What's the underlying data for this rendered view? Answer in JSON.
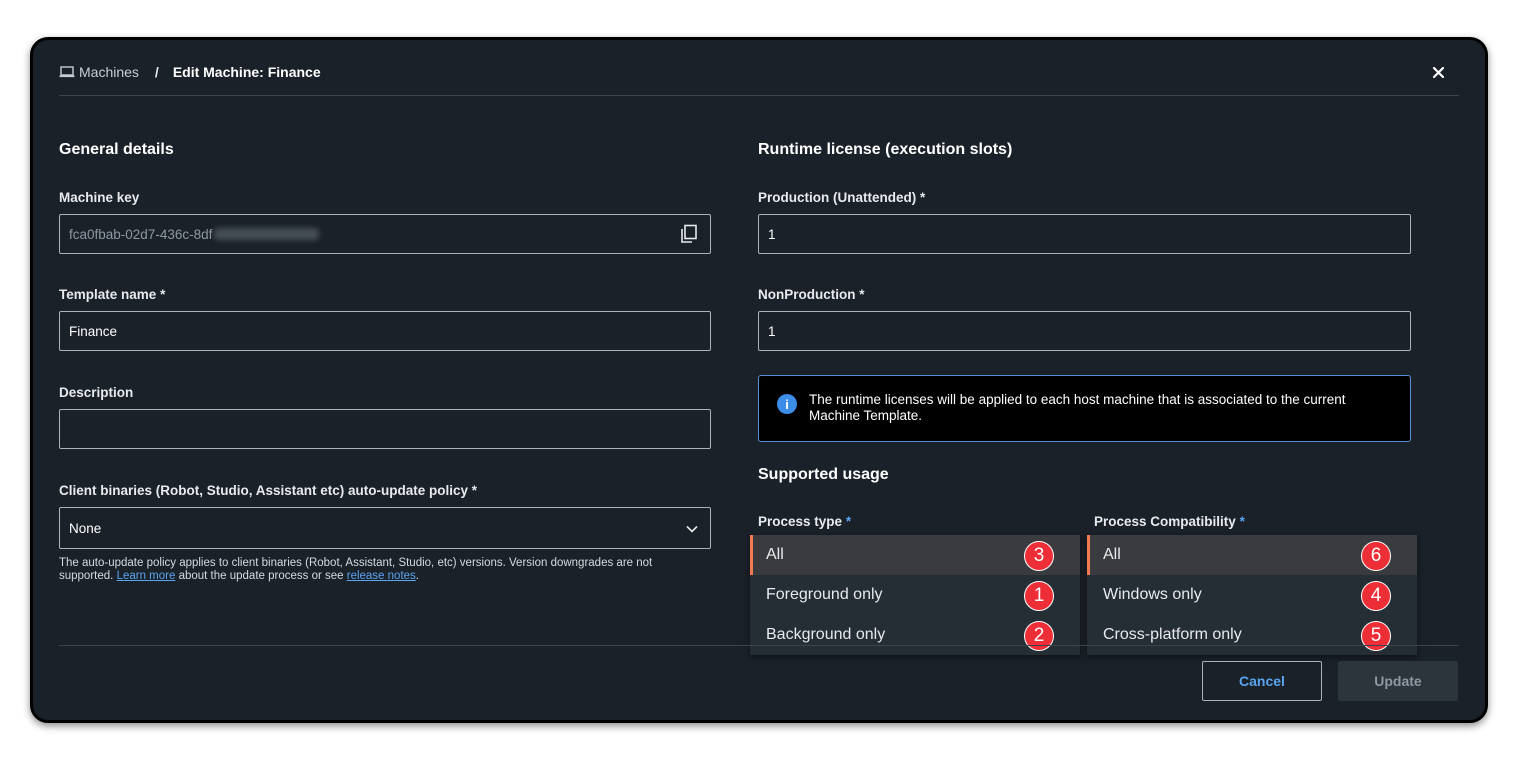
{
  "breadcrumb": {
    "root": "Machines",
    "separator": "/",
    "current": "Edit Machine: Finance"
  },
  "general": {
    "title": "General details",
    "machine_key_label": "Machine key",
    "machine_key_value": "fca0fbab-02d7-436c-8df",
    "template_name_label": "Template name",
    "template_name_value": "Finance",
    "description_label": "Description",
    "description_value": "",
    "update_policy_label": "Client binaries (Robot, Studio, Assistant etc) auto-update policy",
    "update_policy_value": "None",
    "helper_part1": "The auto-update policy applies to client binaries (Robot, Assistant, Studio, etc) versions. Version downgrades are not supported.",
    "helper_link1": "Learn more",
    "helper_part2": "about the update process or see",
    "helper_link2": "release notes",
    "helper_end": "."
  },
  "runtime": {
    "title": "Runtime license (execution slots)",
    "production_label": "Production (Unattended)",
    "production_value": "1",
    "nonproduction_label": "NonProduction",
    "nonproduction_value": "1",
    "info_text": "The runtime licenses will be applied to each host machine that is associated to the current Machine Template."
  },
  "usage": {
    "title": "Supported usage",
    "process_type_label": "Process type",
    "process_compat_label": "Process Compatibility",
    "process_type_options": [
      {
        "label": "All",
        "badge": "3",
        "selected": true
      },
      {
        "label": "Foreground only",
        "badge": "1"
      },
      {
        "label": "Background only",
        "badge": "2"
      }
    ],
    "process_compat_options": [
      {
        "label": "All",
        "badge": "6",
        "selected": true
      },
      {
        "label": "Windows only",
        "badge": "4"
      },
      {
        "label": "Cross-platform only",
        "badge": "5"
      }
    ]
  },
  "required_marker": "*",
  "footer": {
    "cancel_label": "Cancel",
    "update_label": "Update"
  },
  "colors": {
    "accent": "#5aa4f0",
    "selected_indicator": "#f07a52",
    "badge": "#ee2e36",
    "background": "#1b2129"
  },
  "icons": {
    "breadcrumb": "laptop-icon",
    "close": "close-icon",
    "copy": "copy-icon",
    "dropdown": "chevron-down-icon",
    "info": "info-icon"
  }
}
